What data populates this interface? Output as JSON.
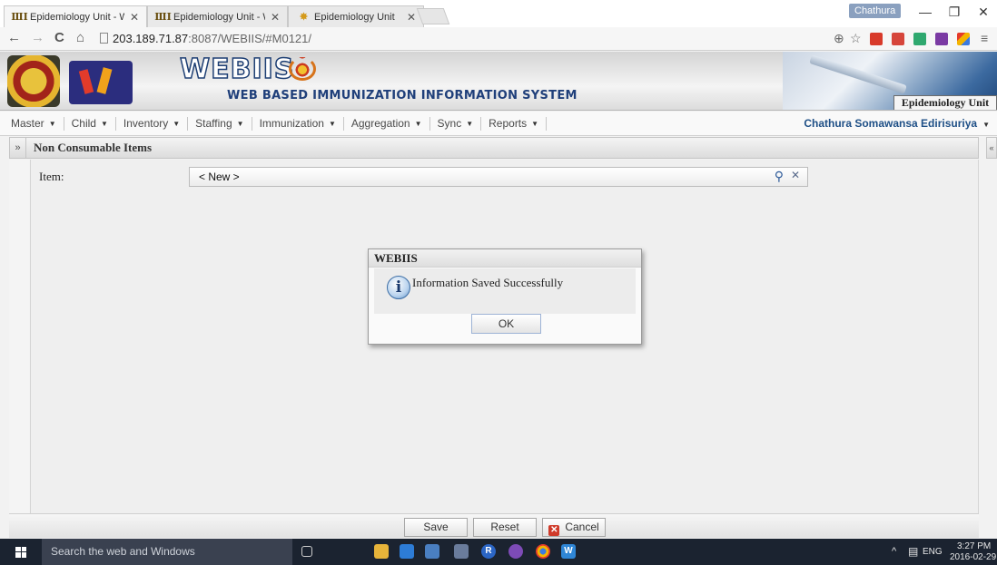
{
  "browser": {
    "tabs": [
      {
        "title": "Epidemiology Unit - WEBII",
        "active": true
      },
      {
        "title": "Epidemiology Unit - WEBII",
        "active": false
      },
      {
        "title": "Epidemiology Unit",
        "active": false
      }
    ],
    "profile_name": "Chathura",
    "url_host": "203.189.71.87",
    "url_path": ":8087/WEBIIS/#M0121/"
  },
  "banner": {
    "app_name": "WEBIIS",
    "app_subtitle": "WEB BASED IMMUNIZATION INFORMATION SYSTEM",
    "unit_name": "Epidemiology Unit"
  },
  "menu": {
    "items": [
      "Master",
      "Child",
      "Inventory",
      "Staffing",
      "Immunization",
      "Aggregation",
      "Sync",
      "Reports"
    ],
    "user": "Chathura Somawansa Edirisuriya"
  },
  "panel": {
    "title": "Non Consumable Items",
    "item_label": "Item:",
    "item_value": "< New >"
  },
  "dialog": {
    "title": "WEBIIS",
    "message": "Information Saved Successfully",
    "ok_label": "OK"
  },
  "toolbar": {
    "save_label": "Save",
    "reset_label": "Reset",
    "cancel_label": "Cancel"
  },
  "taskbar": {
    "search_placeholder": "Search the web and Windows",
    "language": "ENG",
    "time": "3:27 PM",
    "date": "2016-02-29"
  },
  "colors": {
    "brand_blue": "#1e4f86",
    "taskbar": "#1b2330"
  }
}
